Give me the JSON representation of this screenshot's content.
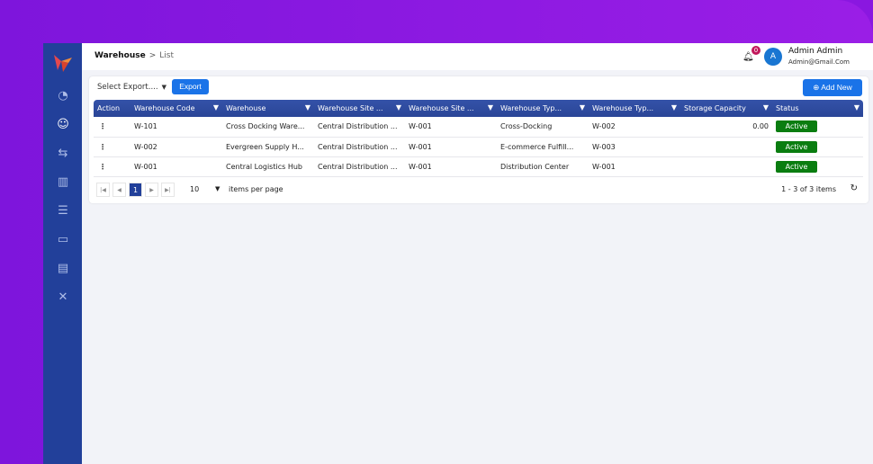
{
  "breadcrumb": {
    "root": "Warehouse",
    "current": "List"
  },
  "user": {
    "notifications": "0",
    "initial": "A",
    "name": "Admin Admin",
    "email": "Admin@Gmail.Com"
  },
  "toolbar": {
    "export_select": "Select Export....",
    "export_label": "Export",
    "add_new_label": "Add New"
  },
  "sidebar": {
    "items": [
      {
        "icon": "dashboard-gauge-icon"
      },
      {
        "icon": "user-circle-icon",
        "active": true
      },
      {
        "icon": "transfer-arrows-icon"
      },
      {
        "icon": "barcode-icon"
      },
      {
        "icon": "database-icon"
      },
      {
        "icon": "scroll-icon"
      },
      {
        "icon": "report-icon"
      },
      {
        "icon": "tools-icon"
      }
    ]
  },
  "table": {
    "columns": [
      "Action",
      "Warehouse Code",
      "Warehouse",
      "Warehouse Site ...",
      "Warehouse Site ...",
      "Warehouse Typ...",
      "Warehouse Typ...",
      "Storage Capacity",
      "Status"
    ],
    "rows": [
      [
        "W-101",
        "Cross Docking Ware...",
        "Central Distribution ...",
        "W-001",
        "Cross-Docking",
        "W-002",
        "0.00",
        "Active"
      ],
      [
        "W-002",
        "Evergreen Supply H...",
        "Central Distribution ...",
        "W-001",
        "E-commerce Fulfill...",
        "W-003",
        "",
        "Active"
      ],
      [
        "W-001",
        "Central Logistics Hub",
        "Central Distribution ...",
        "W-001",
        "Distribution Center",
        "W-001",
        "",
        "Active"
      ]
    ]
  },
  "pager": {
    "page": "1",
    "page_size": "10",
    "items_per_page": "items per page",
    "info": "1 - 3 of 3 items"
  },
  "colors": {
    "sidebar": "#22409a",
    "accent": "#1a73e8",
    "status_active": "#0a7d10",
    "background": "#8a17e0"
  }
}
